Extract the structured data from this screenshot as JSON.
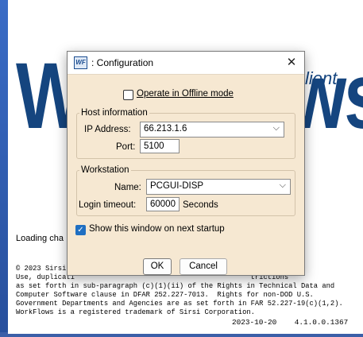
{
  "splash": {
    "brand_word": "WorkFlows",
    "client_word": "lient",
    "loading_text": "Loading cha",
    "legal_lines": [
      "© 2023 Sirsi",
      "Use, duplicati                                          trictions",
      "as set forth in sub-paragraph (c)(1)(ii) of the Rights in Technical Data and",
      "Computer Software clause in DFAR 252.227-7013.  Rights for non-DOD U.S.",
      "Government Departments and Agencies are as set forth in FAR 52.227-19(c)(1,2).",
      "WorkFlows is a registered trademark of Sirsi Corporation."
    ],
    "date": "2023-10-20",
    "version": "4.1.0.0.1367"
  },
  "dialog": {
    "icon_text": "WF",
    "title": ": Configuration",
    "close_glyph": "✕",
    "offline_label": "Operate in Offline mode",
    "host_group": "Host information",
    "ip_label": "IP Address:",
    "ip_value": "66.213.1.6",
    "port_label": "Port:",
    "port_value": "5100",
    "workstation_group": "Workstation",
    "name_label": "Name:",
    "name_value": "PCGUI-DISP",
    "timeout_label": "Login timeout:",
    "timeout_value": "60000",
    "timeout_unit": "Seconds",
    "show_label": "Show this window on next startup",
    "ok_label": "OK",
    "cancel_label": "Cancel",
    "chevron_glyph": "⌵",
    "check_glyph": "✓"
  },
  "colors": {
    "brand": "#15457f",
    "dialog_bg": "#f6e8d2",
    "accent": "#1f6fc2"
  }
}
